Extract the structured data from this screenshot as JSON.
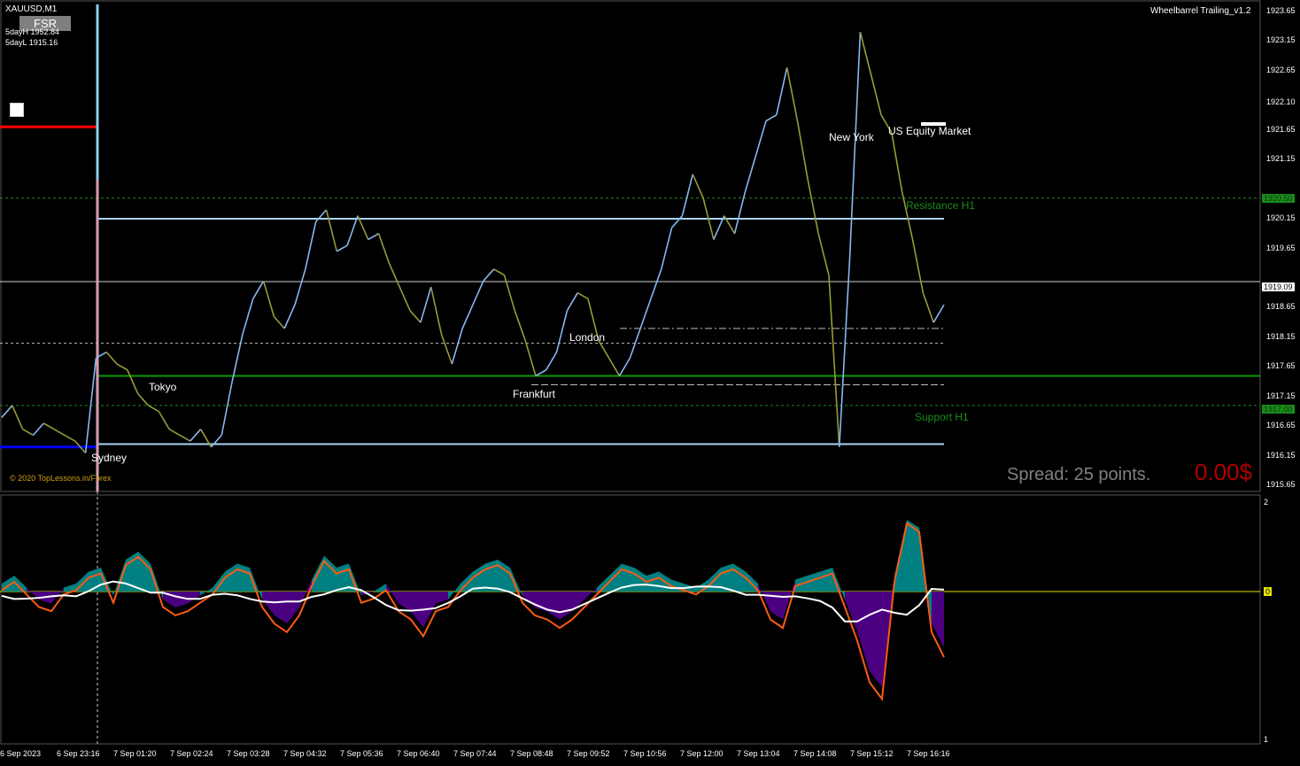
{
  "header": {
    "symbol": "XAUUSD,M1",
    "expert": "Wheelbarrel Trailing_v1.2",
    "fsr": "FSR",
    "day_high": "5dayH 1952.84",
    "day_low": "5dayL 1915.16",
    "copyright": "© 2020 TopLessons.in/Forex"
  },
  "overlay": {
    "spread": "Spread: 25 points.",
    "pnl": "0.00$"
  },
  "sessions": {
    "sydney": "Sydney",
    "tokyo": "Tokyo",
    "frankfurt": "Frankfurt",
    "london": "London",
    "new_york": "New York",
    "us_equity": "US Equity Market"
  },
  "levels": {
    "resistance": "Resistance H1",
    "support": "Support H1",
    "resistance_value": "1920.50",
    "support_value": "1917.00",
    "current_value": "1919.09"
  },
  "colors": {
    "price_up": "#87b8f0",
    "price_down": "#9a9a3a",
    "resistance": "#1a8c1a",
    "teal": "#008080",
    "purple": "#4b0082",
    "orange": "#ff5a14",
    "sydney_line": "#0000ff",
    "red_line": "#ff0000"
  },
  "chart_data": [
    {
      "type": "line",
      "name": "price",
      "y_ticks": [
        "1923.65",
        "1923.15",
        "1922.65",
        "1922.10",
        "1921.65",
        "1921.15",
        "1920.15",
        "1919.65",
        "1918.65",
        "1918.15",
        "1917.65",
        "1917.15",
        "1916.65",
        "1916.15",
        "1915.65"
      ],
      "x_ticks": [
        "6 Sep 2023",
        "6 Sep 23:16",
        "7 Sep 01:20",
        "7 Sep 02:24",
        "7 Sep 03:28",
        "7 Sep 04:32",
        "7 Sep 05:36",
        "7 Sep 06:40",
        "7 Sep 07:44",
        "7 Sep 08:48",
        "7 Sep 09:52",
        "7 Sep 10:56",
        "7 Sep 12:00",
        "7 Sep 13:04",
        "7 Sep 14:08",
        "7 Sep 15:12",
        "7 Sep 16:16"
      ],
      "ylim": [
        1915.55,
        1923.75
      ],
      "values": [
        1916.8,
        1917.0,
        1916.6,
        1916.5,
        1916.7,
        1916.6,
        1916.5,
        1916.4,
        1916.2,
        1917.8,
        1917.9,
        1917.7,
        1917.6,
        1917.2,
        1917.0,
        1916.9,
        1916.6,
        1916.5,
        1916.4,
        1916.6,
        1916.3,
        1916.5,
        1917.4,
        1918.2,
        1918.8,
        1919.1,
        1918.5,
        1918.3,
        1918.7,
        1919.3,
        1920.1,
        1920.3,
        1919.6,
        1919.7,
        1920.2,
        1919.8,
        1919.9,
        1919.4,
        1919.0,
        1918.6,
        1918.4,
        1919.0,
        1918.2,
        1917.7,
        1918.3,
        1918.7,
        1919.1,
        1919.3,
        1919.2,
        1918.6,
        1918.1,
        1917.5,
        1917.6,
        1917.9,
        1918.6,
        1918.9,
        1918.8,
        1918.1,
        1917.8,
        1917.5,
        1917.8,
        1918.3,
        1918.8,
        1919.3,
        1920.0,
        1920.2,
        1920.9,
        1920.5,
        1919.8,
        1920.2,
        1919.9,
        1920.6,
        1921.2,
        1921.8,
        1921.9,
        1922.7,
        1921.8,
        1920.8,
        1919.9,
        1919.2,
        1916.3,
        1919.5,
        1923.3,
        1922.6,
        1921.9,
        1921.6,
        1920.6,
        1919.8,
        1918.9,
        1918.4,
        1918.7
      ]
    },
    {
      "type": "area",
      "name": "oscillator",
      "y_ticks": [
        "2",
        "0",
        "1"
      ],
      "values": [
        0.1,
        0.2,
        0.05,
        -0.1,
        -0.15,
        0.05,
        0.1,
        0.25,
        0.3,
        -0.05,
        0.4,
        0.5,
        0.35,
        -0.1,
        -0.2,
        -0.15,
        -0.05,
        0.05,
        0.25,
        0.35,
        0.3,
        -0.1,
        -0.3,
        -0.4,
        -0.2,
        0.15,
        0.45,
        0.3,
        0.35,
        -0.05,
        0.0,
        0.1,
        -0.15,
        -0.25,
        -0.45,
        -0.15,
        -0.1,
        0.1,
        0.25,
        0.35,
        0.4,
        0.3,
        -0.05,
        -0.2,
        -0.25,
        -0.35,
        -0.25,
        -0.1,
        0.05,
        0.2,
        0.35,
        0.3,
        0.2,
        0.25,
        0.15,
        0.1,
        0.05,
        0.15,
        0.3,
        0.35,
        0.25,
        0.1,
        -0.25,
        -0.35,
        0.15,
        0.2,
        0.25,
        0.3,
        -0.1,
        -0.5,
        -1.0,
        -1.2,
        0.2,
        0.9,
        0.8,
        -0.4,
        -0.7
      ]
    }
  ]
}
